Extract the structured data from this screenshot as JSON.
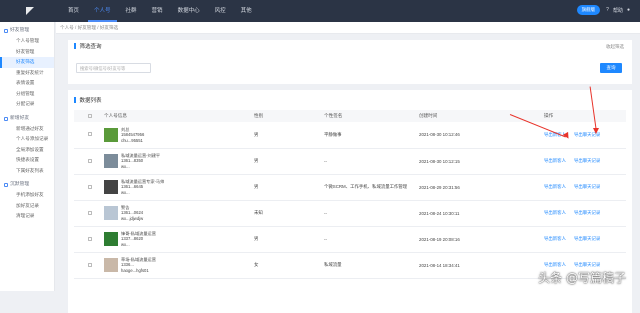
{
  "nav": {
    "items": [
      "首页",
      "个人号",
      "社群",
      "营销",
      "数据中心",
      "风控",
      "其他"
    ],
    "active_index": 1,
    "badge_label": "旗舰版",
    "help_label": "帮助"
  },
  "sidebar": {
    "group1_title": "好友管理",
    "group1_items": [
      "个人号管理",
      "好友管理",
      "好友筛选",
      "重复好友统计",
      "表情设置",
      "分组管理",
      "分配记录"
    ],
    "group2_title": "新增好友",
    "group2_items": [
      "新增通过好友",
      "个人号添加记录",
      "全局添加设置",
      "快捷表设置",
      "下属好友列表"
    ],
    "group3_title": "沉默管理",
    "group3_items": [
      "手机添加好友",
      "加好友记录",
      "清理记录"
    ],
    "active_item": "好友筛选"
  },
  "breadcrumb": "个人号 / 好友管理 / 好友筛选",
  "filter": {
    "title": "筛选查询",
    "collapse_label": "收起筛选",
    "search_placeholder": "搜索号/微信号/好友号等",
    "query_label": "查询"
  },
  "list": {
    "title": "数据列表",
    "columns": [
      "",
      "个人号信息",
      "性别",
      "个性签名",
      "创建时间",
      "操作"
    ],
    "rows": [
      {
        "name": "刘总",
        "id1": "1584547956",
        "id2": "chu...95551",
        "gender": "男",
        "signature": "平静做事",
        "created": "2021-08-30 10:12:46"
      },
      {
        "name": "私域流量运营-刘建平",
        "id1": "1361...8350",
        "id2": "wx...",
        "gender": "男",
        "signature": "--",
        "created": "2021-08-30 10:12:15"
      },
      {
        "name": "私域流量运营专家-马帅",
        "id1": "1361...6645",
        "id2": "wx...",
        "gender": "男",
        "signature": "个微SCRM、工作手机、私域流量工作管理",
        "created": "2021-08-29 20:31:56"
      },
      {
        "name": "警告",
        "id1": "1361...0624",
        "id2": "wx...jdjwdjw",
        "gender": "未知",
        "signature": "--",
        "created": "2021-08-24 10:30:11"
      },
      {
        "name": "锋哥-私域流量运营",
        "id1": "1337...8620",
        "id2": "wx...",
        "gender": "男",
        "signature": "--",
        "created": "2021-08-19 20:08:16"
      },
      {
        "name": "草场-私域流量运营",
        "id1": "1336...",
        "id2": "haoge...hgfs01",
        "gender": "女",
        "signature": "私域流量",
        "created": "2021-08-14 18:34:41"
      }
    ],
    "op_view_friends": "导出新客人",
    "op_view_chat": "导出聊天记录"
  },
  "watermark": "头条 @写篇稿子"
}
